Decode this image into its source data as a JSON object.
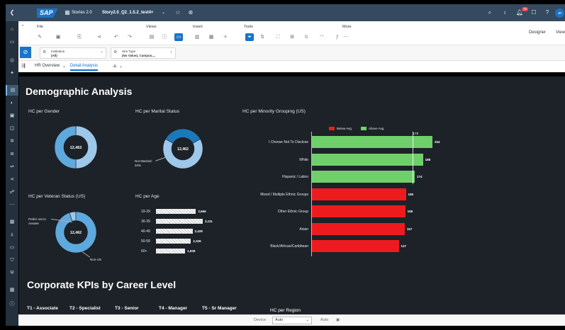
{
  "shell": {
    "logo": "SAP",
    "app": "Stories 2.0",
    "story_title": "Story2.0_Q2_1.5.2_test4+",
    "notification_count": "16",
    "avatar": "JR"
  },
  "toolbar": {
    "groups": [
      "File",
      "Views",
      "Insert",
      "Tools",
      "More"
    ],
    "designer_label": "Designer",
    "view_label": "View"
  },
  "filters": [
    {
      "label": "Institution",
      "value": "(All)"
    },
    {
      "label": "Hire Type",
      "value": "(No Value), Campus,..."
    }
  ],
  "tabs": [
    "HR Overview",
    "Detail Analysis"
  ],
  "page": {
    "heading": "Demographic Analysis",
    "section2": "Corporate KPIs by Career Level"
  },
  "gender": {
    "title": "HC per Gender",
    "total": "12,462"
  },
  "marital": {
    "title": "HC per Marital Status",
    "total": "12,462",
    "callout": "Not Married:",
    "callout_pct": "34%"
  },
  "veteran": {
    "title": "HC per Veteran Status (US)",
    "total": "12,462",
    "callout1": "Prefer not to",
    "callout1b": "Answer",
    "callout2": "Non-US"
  },
  "age": {
    "title": "HC per Age"
  },
  "minority": {
    "title": "HC per Minority Grouping (US)",
    "legend_below": "Below Avg",
    "legend_above": "Above Avg",
    "avg_label": "170"
  },
  "kpis": [
    "T1 - Associate",
    "T2 - Specialist",
    "T3 - Senior",
    "T4 - Manager",
    "T5 - Sr Manager"
  ],
  "region_title": "HC per Region",
  "footer": {
    "device_label": "Device:",
    "device_value": "Auto",
    "auto_label": "Auto"
  },
  "chart_data": [
    {
      "type": "pie",
      "title": "HC per Gender",
      "center": "12,462",
      "slices": [
        {
          "value": 0.5
        },
        {
          "value": 0.5
        }
      ]
    },
    {
      "type": "pie",
      "title": "HC per Marital Status",
      "center": "12,462",
      "slices": [
        {
          "label": "Not Married",
          "value": 0.34
        },
        {
          "value": 0.66
        }
      ]
    },
    {
      "type": "pie",
      "title": "HC per Veteran Status (US)",
      "center": "12,462",
      "slices": [
        {
          "label": "Prefer not to Answer",
          "value": 0.05
        },
        {
          "label": "Non-US",
          "value": 0.95
        }
      ]
    },
    {
      "type": "bar",
      "title": "HC per Age",
      "categories": [
        "19-29",
        "30-39",
        "40-49",
        "50-59",
        "60+"
      ],
      "values": [
        2656,
        3111,
        2428,
        2326,
        1939
      ],
      "labels": [
        "2,656",
        "3,111",
        "2,428",
        "2,326",
        "1,939"
      ],
      "xlim": [
        0,
        3300
      ]
    },
    {
      "type": "bar",
      "title": "HC per Minority Grouping (US)",
      "categories": [
        "I Choose Not To Disclose",
        "White",
        "Hispanic / Latino",
        "Mixed / Multiple Ethnic Groups",
        "Other Ethnic Group",
        "Asian",
        "Black/African/Caribbean"
      ],
      "values": [
        204,
        188,
        174,
        159,
        158,
        157,
        147
      ],
      "status": [
        "above",
        "above",
        "above",
        "below",
        "below",
        "below",
        "below"
      ],
      "average": 170,
      "xlim": [
        0,
        240
      ]
    }
  ],
  "colors": {
    "above": "#6fd06b",
    "below": "#ee1b1e",
    "donut_light": "#9ec8ea",
    "donut_dark": "#1d78b9",
    "donut_mid": "#5ea9dd"
  }
}
